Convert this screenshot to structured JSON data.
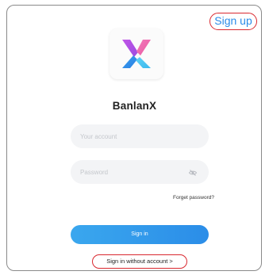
{
  "header": {
    "signup_label": "Sign up"
  },
  "app": {
    "name": "BanlanX",
    "logo_icon": "banlanx-x-logo",
    "brand_colors": {
      "purple": "#b94ee6",
      "pink": "#f06bb4",
      "blue": "#2f8ee9",
      "cyan": "#4fc9f2"
    }
  },
  "form": {
    "account_placeholder": "Your account",
    "password_placeholder": "Password",
    "password_toggle_icon": "eye-off-icon",
    "forgot_label": "Forget password?",
    "signin_label": "Sign in",
    "guest_label": "Sign in without account >"
  },
  "colors": {
    "accent": "#2b8ce8",
    "highlight_ring": "#d9282f",
    "field_bg": "#f3f4f6"
  }
}
